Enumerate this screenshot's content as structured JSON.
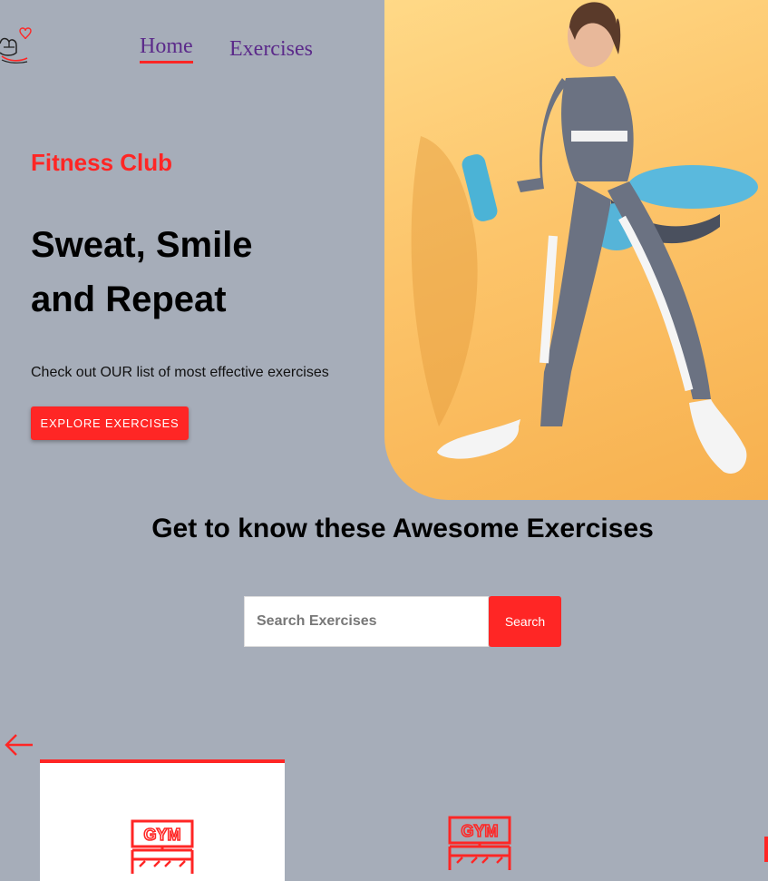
{
  "nav": {
    "links": [
      {
        "label": "Home",
        "active": true
      },
      {
        "label": "Exercises",
        "active": false
      }
    ]
  },
  "hero": {
    "subtitle": "Fitness Club",
    "headline_line1": "Sweat, Smile",
    "headline_line2": "and Repeat",
    "description": "Check out OUR list of most effective exercises",
    "cta_label": "EXPLORE EXERCISES"
  },
  "exercises_section": {
    "title": "Get to know these Awesome Exercises",
    "search": {
      "placeholder": "Search Exercises",
      "value": "",
      "button_label": "Search"
    }
  },
  "carousel": {
    "cards": [
      {
        "icon": "gym-icon",
        "label": "",
        "active": true
      },
      {
        "icon": "gym-icon",
        "label": "",
        "active": false
      }
    ]
  },
  "colors": {
    "accent": "#ff2625",
    "page_bg": "#a6adb9",
    "nav_link": "#5b2a8a"
  }
}
